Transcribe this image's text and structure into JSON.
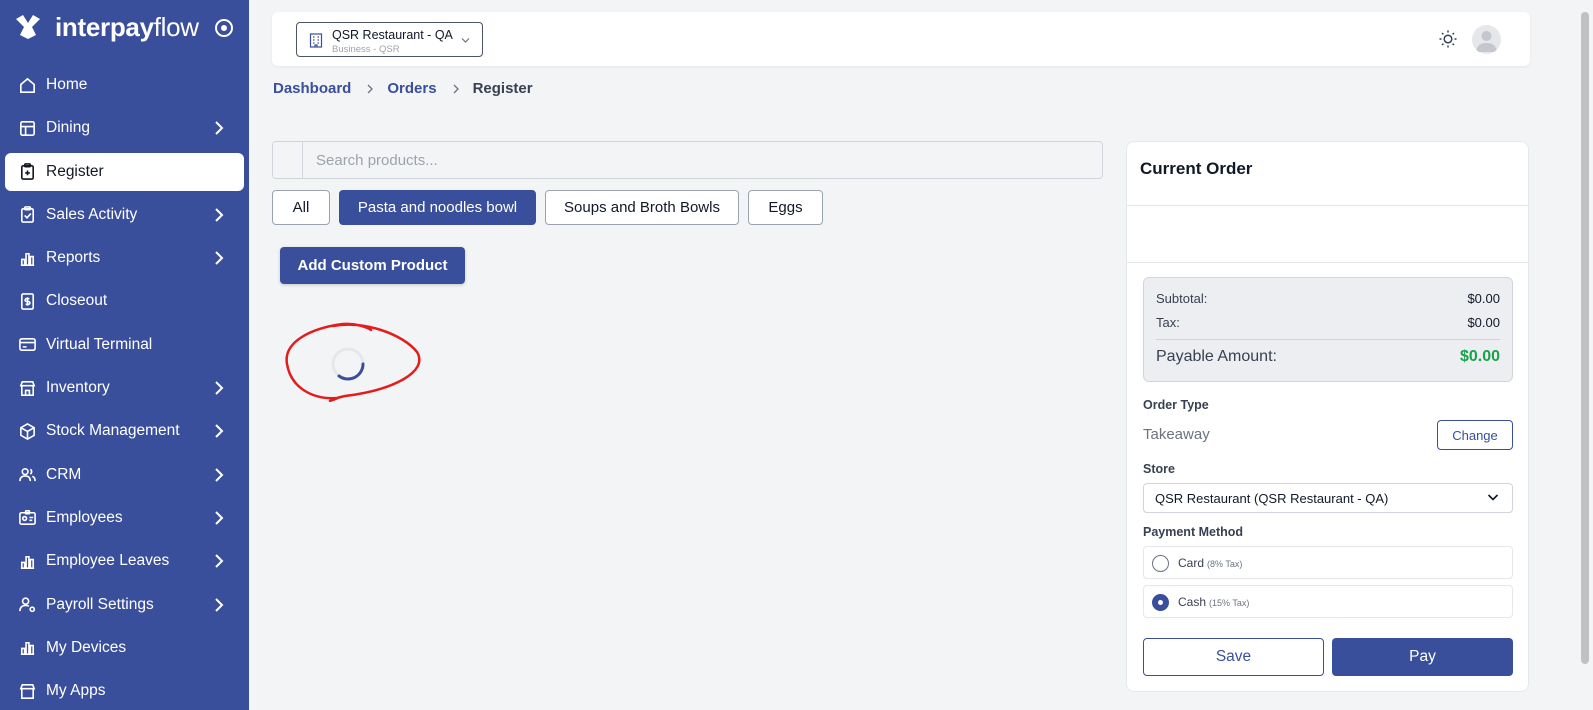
{
  "brand": {
    "name_bold": "interpay",
    "name_light": "flow"
  },
  "sidebar": {
    "items": [
      {
        "label": "Home",
        "icon": "home-icon",
        "chevron": false,
        "active": false
      },
      {
        "label": "Dining",
        "icon": "table-icon",
        "chevron": true,
        "active": false
      },
      {
        "label": "Register",
        "icon": "clipboard-icon",
        "chevron": false,
        "active": true
      },
      {
        "label": "Sales Activity",
        "icon": "clipboard-check-icon",
        "chevron": true,
        "active": false
      },
      {
        "label": "Reports",
        "icon": "bar-chart-icon",
        "chevron": true,
        "active": false
      },
      {
        "label": "Closeout",
        "icon": "dollar-doc-icon",
        "chevron": false,
        "active": false
      },
      {
        "label": "Virtual Terminal",
        "icon": "card-icon",
        "chevron": false,
        "active": false
      },
      {
        "label": "Inventory",
        "icon": "store-icon",
        "chevron": true,
        "active": false
      },
      {
        "label": "Stock Management",
        "icon": "box-icon",
        "chevron": true,
        "active": false
      },
      {
        "label": "CRM",
        "icon": "users-icon",
        "chevron": true,
        "active": false
      },
      {
        "label": "Employees",
        "icon": "id-badge-icon",
        "chevron": true,
        "active": false
      },
      {
        "label": "Employee Leaves",
        "icon": "bar-chart-icon",
        "chevron": true,
        "active": false
      },
      {
        "label": "Payroll Settings",
        "icon": "user-gear-icon",
        "chevron": true,
        "active": false
      },
      {
        "label": "My Devices",
        "icon": "device-icon",
        "chevron": false,
        "active": false
      },
      {
        "label": "My Apps",
        "icon": "apps-icon",
        "chevron": false,
        "active": false
      }
    ]
  },
  "topbar": {
    "business_name": "QSR Restaurant - QA",
    "business_sub": "Business - QSR"
  },
  "breadcrumb": {
    "items": [
      "Dashboard",
      "Orders"
    ],
    "current": "Register"
  },
  "search": {
    "placeholder": "Search products..."
  },
  "categories": [
    {
      "label": "All",
      "active": false
    },
    {
      "label": "Pasta and noodles bowl",
      "active": true
    },
    {
      "label": "Soups and Broth Bowls",
      "active": false
    },
    {
      "label": "Eggs",
      "active": false
    }
  ],
  "add_custom_product": "Add Custom Product",
  "order": {
    "title": "Current Order",
    "subtotal_label": "Subtotal:",
    "subtotal": "$0.00",
    "tax_label": "Tax:",
    "tax": "$0.00",
    "payable_label": "Payable Amount:",
    "payable": "$0.00",
    "order_type_label": "Order Type",
    "order_type": "Takeaway",
    "change_label": "Change",
    "store_label": "Store",
    "store_value": "QSR Restaurant (QSR Restaurant - QA)",
    "payment_label": "Payment Method",
    "payment_options": [
      {
        "label": "Card",
        "note": "(8% Tax)",
        "checked": false
      },
      {
        "label": "Cash",
        "note": "(15% Tax)",
        "checked": true
      }
    ],
    "save_label": "Save",
    "pay_label": "Pay"
  },
  "colors": {
    "primary": "#3a4f9b",
    "success": "#16a34a",
    "annotation": "#e11d1d"
  }
}
